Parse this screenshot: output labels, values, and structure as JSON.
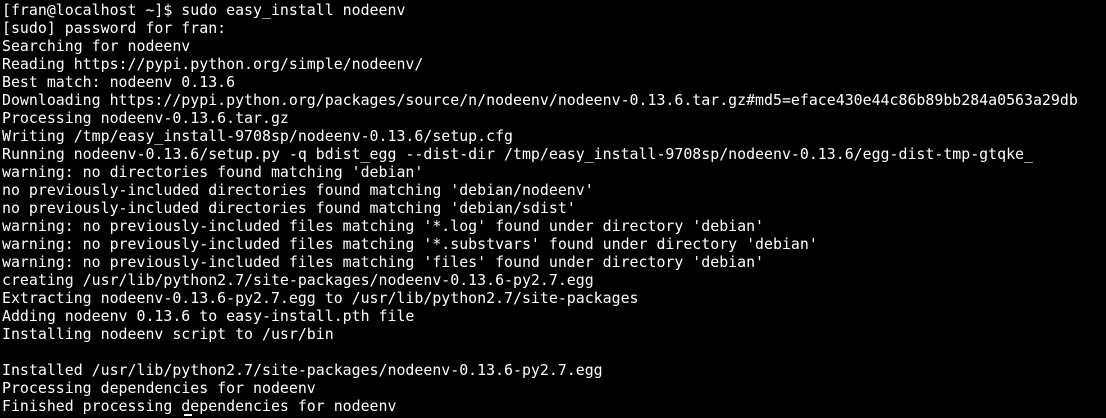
{
  "terminal": {
    "lines": [
      "[fran@localhost ~]$ sudo easy_install nodeenv",
      "[sudo] password for fran:",
      "Searching for nodeenv",
      "Reading https://pypi.python.org/simple/nodeenv/",
      "Best match: nodeenv 0.13.6",
      "Downloading https://pypi.python.org/packages/source/n/nodeenv/nodeenv-0.13.6.tar.gz#md5=eface430e44c86b89bb284a0563a29db",
      "Processing nodeenv-0.13.6.tar.gz",
      "Writing /tmp/easy_install-9708sp/nodeenv-0.13.6/setup.cfg",
      "Running nodeenv-0.13.6/setup.py -q bdist_egg --dist-dir /tmp/easy_install-9708sp/nodeenv-0.13.6/egg-dist-tmp-gtqke_",
      "warning: no directories found matching 'debian'",
      "no previously-included directories found matching 'debian/nodeenv'",
      "no previously-included directories found matching 'debian/sdist'",
      "warning: no previously-included files matching '*.log' found under directory 'debian'",
      "warning: no previously-included files matching '*.substvars' found under directory 'debian'",
      "warning: no previously-included files matching 'files' found under directory 'debian'",
      "creating /usr/lib/python2.7/site-packages/nodeenv-0.13.6-py2.7.egg",
      "Extracting nodeenv-0.13.6-py2.7.egg to /usr/lib/python2.7/site-packages",
      "Adding nodeenv 0.13.6 to easy-install.pth file",
      "Installing nodeenv script to /usr/bin",
      "",
      "Installed /usr/lib/python2.7/site-packages/nodeenv-0.13.6-py2.7.egg",
      "Processing dependencies for nodeenv",
      "Finished processing dependencies for nodeenv"
    ]
  },
  "colors": {
    "background": "#000000",
    "foreground": "#ffffff"
  }
}
